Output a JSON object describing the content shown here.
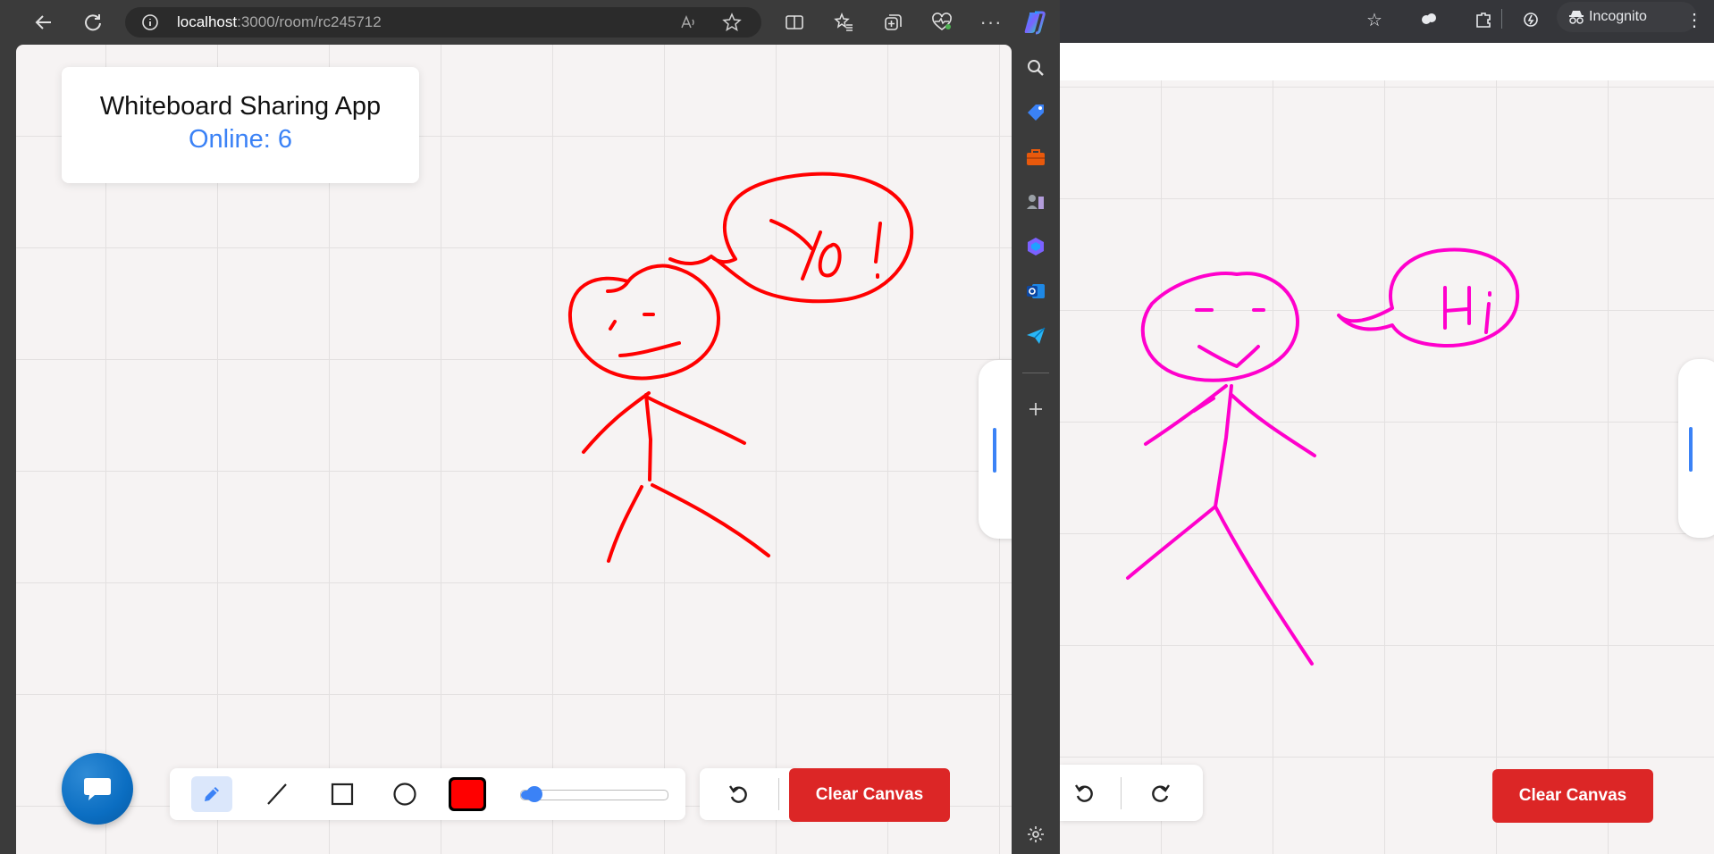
{
  "left_browser": {
    "address": {
      "host": "localhost",
      "path": ":3000/room/rc245712"
    },
    "nav_icons": [
      "back-arrow-icon",
      "refresh-icon",
      "info-icon"
    ],
    "toolbar_icons": [
      "read-aloud-icon",
      "favorite-star-icon",
      "split-screen-icon",
      "favorites-icon",
      "collections-icon",
      "browser-essentials-icon",
      "more-icon",
      "copilot-icon"
    ],
    "sidebar_icons": [
      "search-icon",
      "shopping-tag-icon",
      "tools-icon",
      "games-icon",
      "microsoft-365-icon",
      "outlook-icon",
      "drop-icon",
      "add-icon",
      "settings-icon"
    ]
  },
  "right_browser": {
    "incognito_label": "Incognito",
    "clear_canvas_label": "Clear Canvas"
  },
  "app": {
    "title": "Whiteboard Sharing App",
    "online_label": "Online: 6",
    "clear_canvas_label": "Clear Canvas",
    "tools": [
      "pencil",
      "line",
      "rectangle",
      "circle"
    ],
    "active_tool": "pencil",
    "stroke_color": "#ff0000",
    "brush_size_fraction": 0.1,
    "accent_color": "#3b82f6",
    "danger_color": "#dc2626"
  },
  "drawings": {
    "left_color": "#ff0000",
    "right_color": "#ff00cc"
  }
}
